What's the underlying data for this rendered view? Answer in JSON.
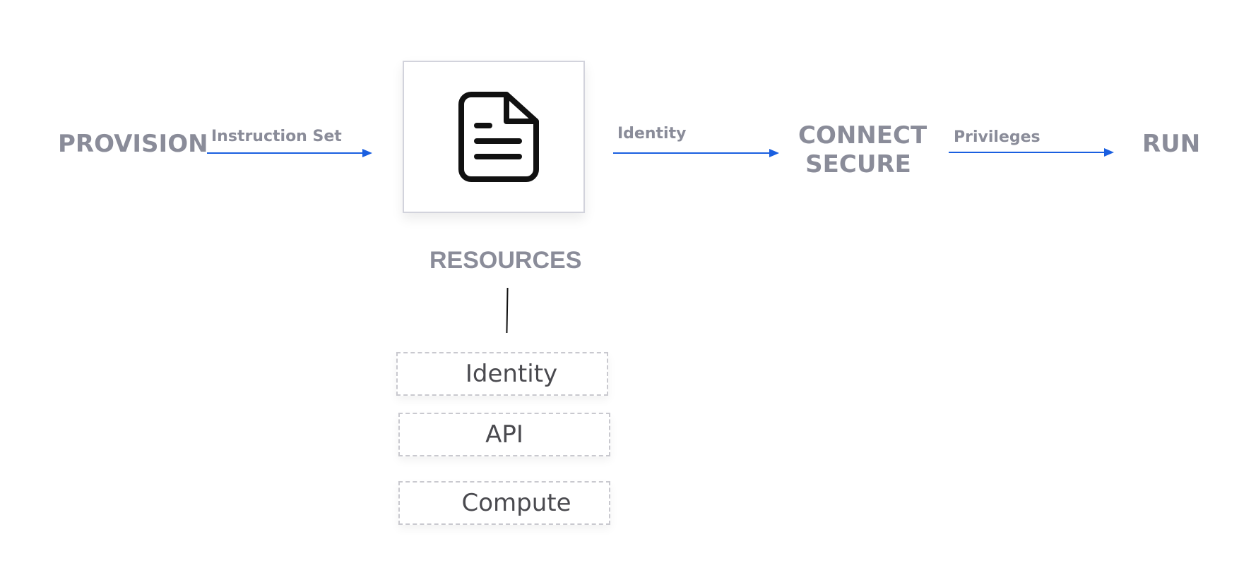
{
  "nodes": {
    "provision": "PROVISION",
    "connect_line1": "CONNECT",
    "connect_line2": "SECURE",
    "run": "RUN",
    "resources": "RESOURCES"
  },
  "edges": {
    "instruction_set": "Instruction Set",
    "identity": "Identity",
    "privileges": "Privileges"
  },
  "resources": {
    "items": [
      "Identity",
      "API",
      "Compute"
    ]
  },
  "icons": {
    "document": "document-icon"
  },
  "colors": {
    "arrow": "#1a5fe0",
    "label": "#8a8c99",
    "box_border": "#d2d3dc",
    "dashed_border": "#c9c9cf"
  }
}
